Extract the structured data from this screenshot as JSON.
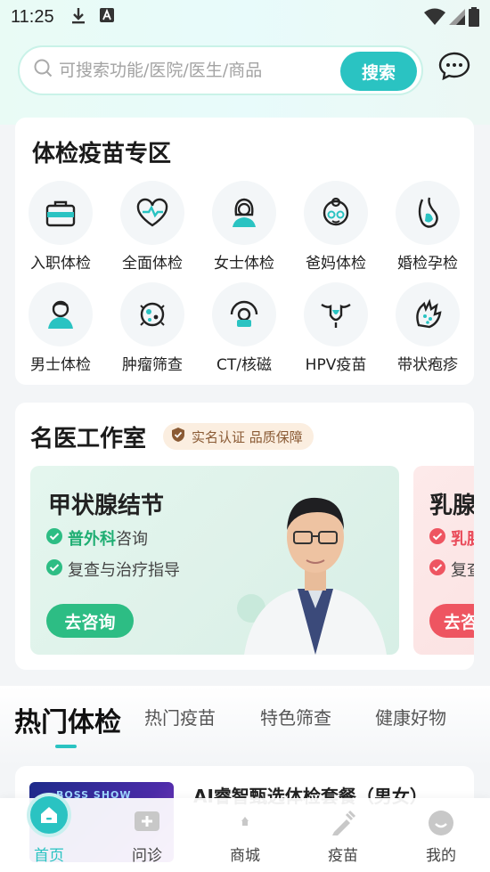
{
  "status_bar": {
    "time": "11:25"
  },
  "search": {
    "placeholder": "可搜索功能/医院/医生/商品",
    "button_label": "搜索"
  },
  "checkup_section": {
    "title": "体检疫苗专区",
    "items": [
      {
        "label": "入职体检",
        "icon": "briefcase-icon"
      },
      {
        "label": "全面体检",
        "icon": "heart-pulse-icon"
      },
      {
        "label": "女士体检",
        "icon": "woman-icon"
      },
      {
        "label": "爸妈体检",
        "icon": "elder-icon"
      },
      {
        "label": "婚检孕检",
        "icon": "pregnancy-icon"
      },
      {
        "label": "男士体检",
        "icon": "man-icon"
      },
      {
        "label": "肿瘤筛查",
        "icon": "tumor-cell-icon"
      },
      {
        "label": "CT/核磁",
        "icon": "ct-scanner-icon"
      },
      {
        "label": "HPV疫苗",
        "icon": "uterus-icon"
      },
      {
        "label": "带状疱疹",
        "icon": "shingles-hand-icon"
      }
    ]
  },
  "doctor_section": {
    "title": "名医工作室",
    "badge": "实名认证 品质保障",
    "cards": [
      {
        "title": "甲状腺结节",
        "line1_em": "普外科",
        "line1_rest": "咨询",
        "line2": "复查与治疗指导",
        "button": "去咨询",
        "accent": "#2dbd84"
      },
      {
        "title": "乳腺",
        "line1_em": "乳腺",
        "line1_rest": "",
        "line2": "复查",
        "button": "去咨",
        "accent": "#ee5561"
      }
    ]
  },
  "tabs": [
    {
      "label": "热门体检",
      "active": true
    },
    {
      "label": "热门疫苗",
      "active": false
    },
    {
      "label": "特色筛查",
      "active": false
    },
    {
      "label": "健康好物",
      "active": false
    }
  ],
  "product": {
    "title": "AI睿智甄选体检套餐（男女）",
    "image_text": "BOSS SHOW"
  },
  "bottom_nav": [
    {
      "label": "首页",
      "active": true
    },
    {
      "label": "问诊",
      "active": false
    },
    {
      "label": "商城",
      "active": false
    },
    {
      "label": "疫苗",
      "active": false
    },
    {
      "label": "我的",
      "active": false
    }
  ],
  "colors": {
    "accent": "#2ac3c2",
    "green": "#2dbd84",
    "red": "#ee5561"
  }
}
